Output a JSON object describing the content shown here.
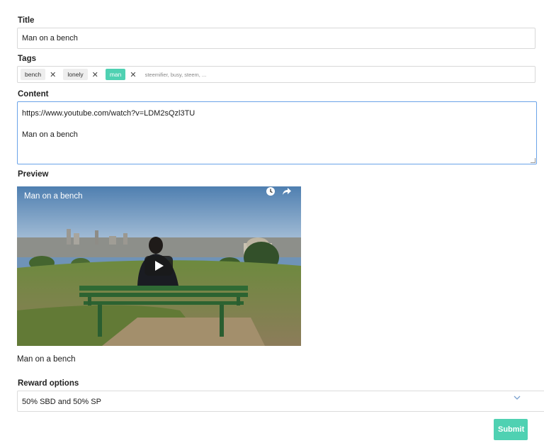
{
  "form": {
    "title_label": "Title",
    "title_value": "Man on a bench",
    "tags_label": "Tags",
    "tags": [
      {
        "label": "bench",
        "active": false
      },
      {
        "label": "lonely",
        "active": false
      },
      {
        "label": "man",
        "active": true
      }
    ],
    "tags_placeholder": "steemifier, busy, steem, ...",
    "content_label": "Content",
    "content_line1": "https://www.youtube.com/watch?v=LDM2sQzl3TU",
    "content_line2": "Man on a bench",
    "preview_label": "Preview",
    "video_title": "Man on a bench",
    "preview_text": "Man on a bench",
    "reward_label": "Reward options",
    "reward_value": "50% SBD and 50% SP",
    "submit_label": "Submit"
  },
  "colors": {
    "accent": "#4fd1b2",
    "focus_border": "#6aa3e8"
  },
  "icons": [
    "close-icon",
    "watch-later-icon",
    "share-icon",
    "play-icon",
    "chevron-down-icon"
  ]
}
